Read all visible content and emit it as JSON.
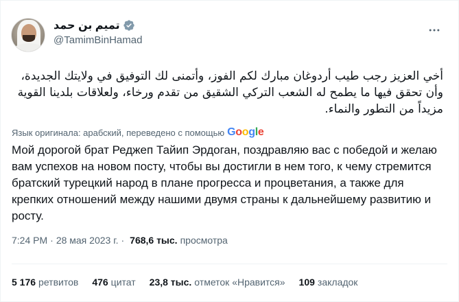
{
  "author": {
    "display_name": "تميم بن حمد",
    "handle": "@TamimBinHamad"
  },
  "more_icon": "more-horizontal-icon",
  "tweet": {
    "arabic_text": "أخي العزيز رجب طيب أردوغان مبارك لكم الفوز، وأتمنى لك التوفيق في ولايتك الجديدة، وأن تحقق فيها ما يطمح له الشعب التركي الشقيق من تقدم ورخاء، ولعلاقات بلدينا القوية مزيداً من التطور والنماء.",
    "translation_note": "Язык оригинала: арабский, переведено с помощью",
    "translation_provider": "Google",
    "translated_text": "Мой дорогой брат Реджеп Тайип Эрдоган, поздравляю вас с победой и желаю вам успехов на новом посту, чтобы вы достигли в нем того, к чему стремится братский турецкий народ в плане прогресса и процветания, а также для крепких отношений между нашими двумя страны к дальнейшему развитию и росту."
  },
  "meta": {
    "time": "7:24 PM",
    "separator": "·",
    "date": "28 мая 2023 г.",
    "views": "768,6 тыс.",
    "views_label": "просмотра"
  },
  "stats": {
    "retweets_count": "5 176",
    "retweets_label": "ретвитов",
    "quotes_count": "476",
    "quotes_label": "цитат",
    "likes_count": "23,8 тыс.",
    "likes_label": "отметок «Нравится»",
    "bookmarks_count": "109",
    "bookmarks_label": "закладок"
  },
  "colors": {
    "verified": "#829aab",
    "secondary_text": "#536471",
    "primary_text": "#0f1419"
  }
}
